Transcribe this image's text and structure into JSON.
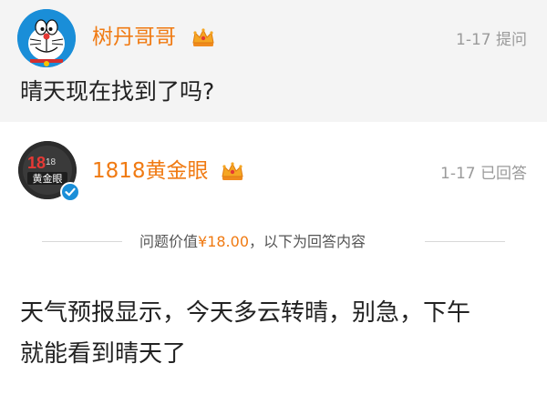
{
  "question": {
    "user_name": "树丹哥哥",
    "meta": "1-17 提问",
    "text": "晴天现在找到了吗?"
  },
  "answer": {
    "user_name": "1818黄金眼",
    "meta": "1-17 已回答",
    "avatar_text": "黄金眼",
    "divider_prefix": "问题价值",
    "price": "¥18.00",
    "divider_suffix": "，以下为回答内容",
    "text_line1": "天气预报显示，今天多云转晴，别急，下午",
    "text_line2": "就能看到晴天了"
  },
  "colors": {
    "accent": "#f07a12",
    "question_bg": "#f4f4f4",
    "verified_blue": "#1a8ed8"
  },
  "icons": {
    "question_avatar": "doraemon-avatar-icon",
    "crown": "crown-icon",
    "verified": "verified-check-icon"
  }
}
